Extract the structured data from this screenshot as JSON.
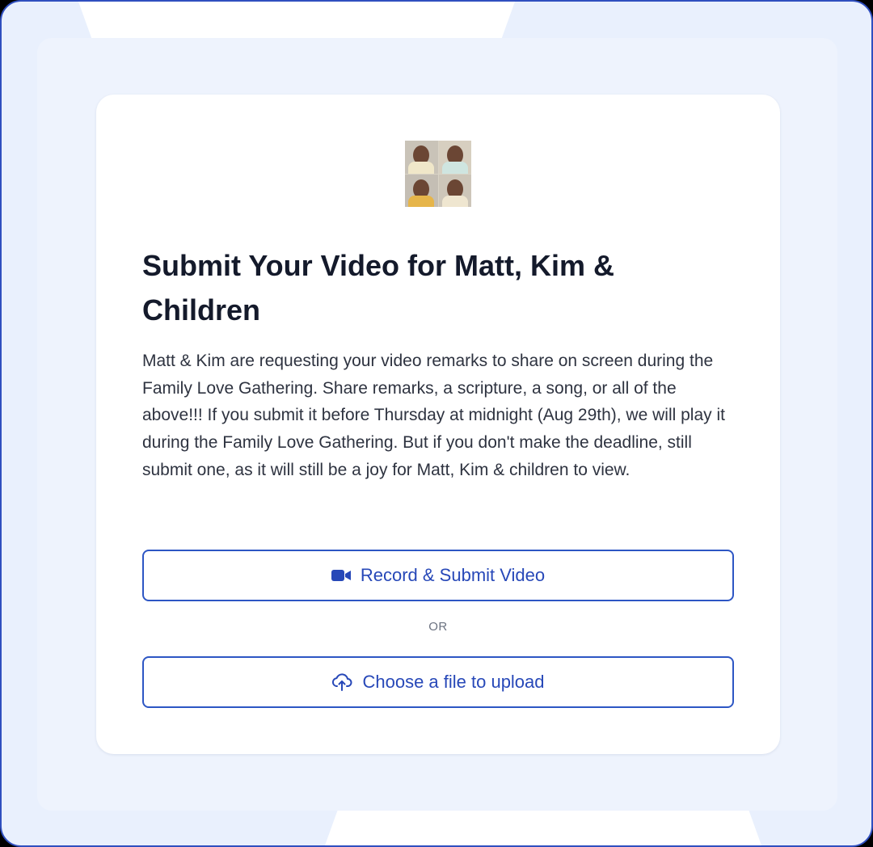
{
  "card": {
    "title": "Submit Your Video for Matt, Kim & Children",
    "description": "Matt & Kim are requesting your video remarks to share on screen during the Family Love Gathering. Share remarks, a scripture, a song, or all of the above!!! If you submit it before Thursday at midnight (Aug 29th), we will play it during the Family Love Gathering. But if you don't make the deadline, still submit one, as it will still be a joy for Matt, Kim & children to view."
  },
  "actions": {
    "record_label": "Record & Submit Video",
    "record_icon": "video-camera-icon",
    "separator": "OR",
    "upload_label": "Choose a file to upload",
    "upload_icon": "cloud-upload-icon"
  },
  "colors": {
    "accent": "#2d56c4",
    "page_background": "#e9f0fd",
    "card_background": "#ffffff",
    "title_text": "#141a2b"
  }
}
